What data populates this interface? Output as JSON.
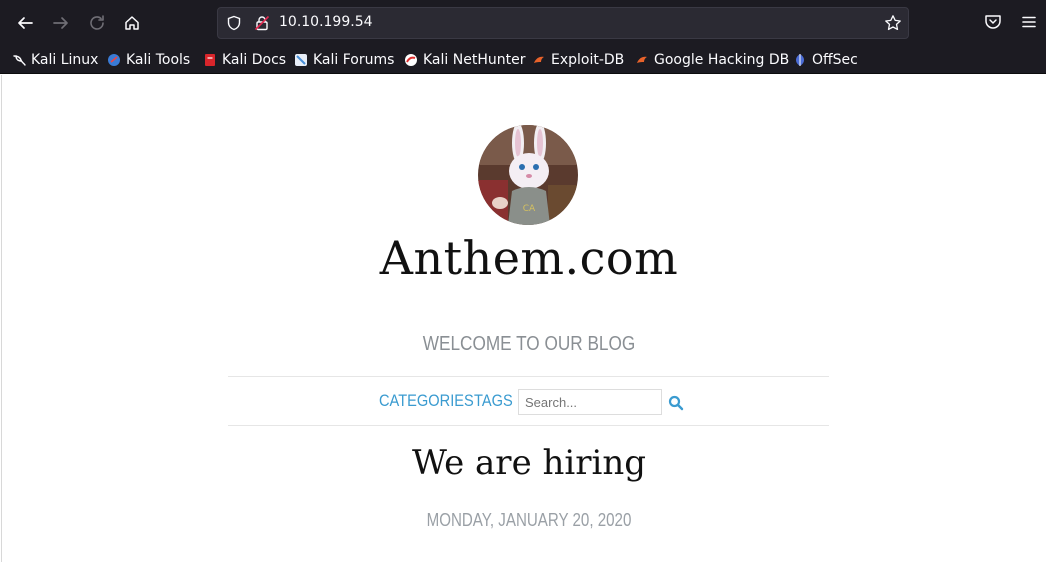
{
  "browser": {
    "url": "10.10.199.54",
    "bookmarks": [
      {
        "label": "Kali Linux",
        "icon": "kali-dragon-icon",
        "color": "#ffffff"
      },
      {
        "label": "Kali Tools",
        "icon": "kali-tools-icon",
        "color": "#3a7bd5"
      },
      {
        "label": "Kali Docs",
        "icon": "kali-docs-icon",
        "color": "#e02020"
      },
      {
        "label": "Kali Forums",
        "icon": "kali-forums-icon",
        "color": "#4a90d9"
      },
      {
        "label": "Kali NetHunter",
        "icon": "kali-nethunter-icon",
        "color": "#e03030"
      },
      {
        "label": "Exploit-DB",
        "icon": "exploit-db-icon",
        "color": "#e8622a"
      },
      {
        "label": "Google Hacking DB",
        "icon": "ghdb-icon",
        "color": "#e8622a"
      },
      {
        "label": "OffSec",
        "icon": "offsec-icon",
        "color": "#4b6cd6"
      }
    ]
  },
  "site": {
    "title": "Anthem.com",
    "tagline": "WELCOME TO OUR BLOG",
    "nav": {
      "categories": "CATEGORIES",
      "tags": "TAGS"
    },
    "search": {
      "placeholder": "Search..."
    },
    "accent_color": "#3a9bd0"
  },
  "post": {
    "title": "We are hiring",
    "date": "MONDAY, JANUARY 20, 2020"
  }
}
